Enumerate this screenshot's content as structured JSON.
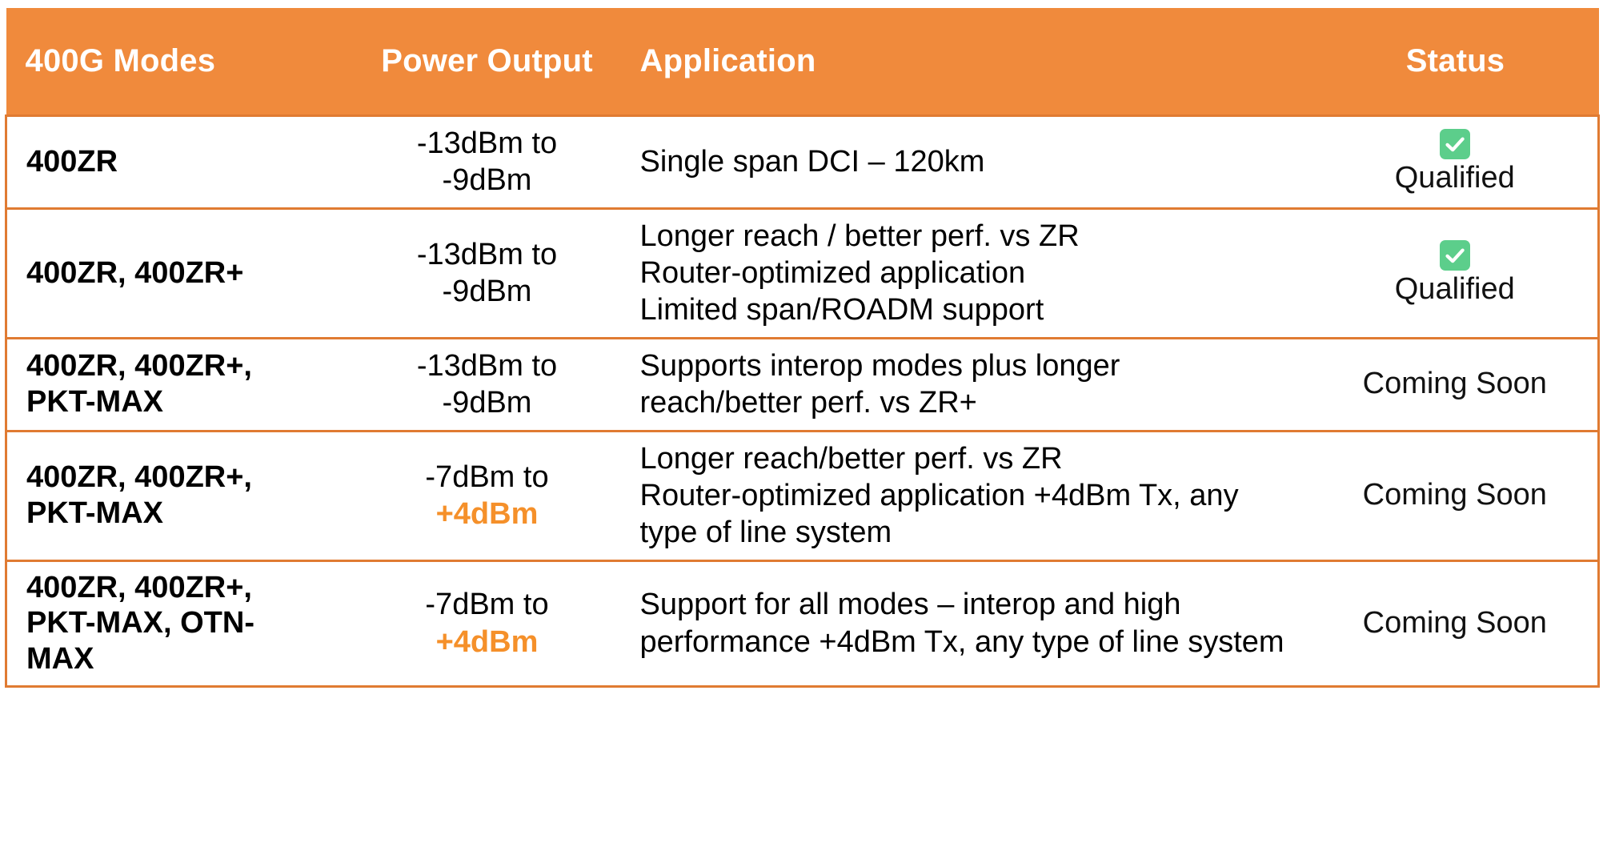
{
  "table": {
    "accent_color": "#F08A3C",
    "border_color": "#E07B32",
    "highlight_color": "#F5902A",
    "check_color": "#5CCE8B",
    "headers": {
      "modes": "400G Modes",
      "power": "Power Output",
      "application": "Application",
      "status": "Status"
    },
    "rows": [
      {
        "modes": [
          "400ZR"
        ],
        "power_lines": [
          "-13dBm to",
          "-9dBm"
        ],
        "power_highlight": null,
        "application": [
          "Single span DCI – 120km"
        ],
        "status": "Qualified",
        "status_icon": "check-mark-button-icon",
        "has_check": true
      },
      {
        "modes": [
          "400ZR, 400ZR+"
        ],
        "power_lines": [
          "-13dBm to",
          "-9dBm"
        ],
        "power_highlight": null,
        "application": [
          "Longer reach / better perf. vs ZR",
          "Router-optimized application",
          "Limited span/ROADM support"
        ],
        "status": "Qualified",
        "status_icon": "check-mark-button-icon",
        "has_check": true
      },
      {
        "modes": [
          "400ZR, 400ZR+,",
          "PKT-MAX"
        ],
        "power_lines": [
          "-13dBm to",
          "-9dBm"
        ],
        "power_highlight": null,
        "application": [
          "Supports interop modes plus longer",
          "reach/better perf. vs ZR+"
        ],
        "status": "Coming Soon",
        "status_icon": null,
        "has_check": false
      },
      {
        "modes": [
          "400ZR, 400ZR+,",
          "PKT-MAX"
        ],
        "power_lines": [
          "-7dBm to"
        ],
        "power_highlight": "+4dBm",
        "application": [
          "Longer reach/better perf. vs ZR",
          "Router-optimized application +4dBm Tx, any",
          "type of line system"
        ],
        "status": "Coming Soon",
        "status_icon": null,
        "has_check": false
      },
      {
        "modes": [
          "400ZR, 400ZR+,",
          "PKT-MAX, OTN-",
          "MAX"
        ],
        "power_lines": [
          "-7dBm to"
        ],
        "power_highlight": "+4dBm",
        "application": [
          "Support for all modes – interop and high",
          "performance +4dBm Tx, any type of line system"
        ],
        "status": "Coming Soon",
        "status_icon": null,
        "has_check": false
      }
    ]
  }
}
